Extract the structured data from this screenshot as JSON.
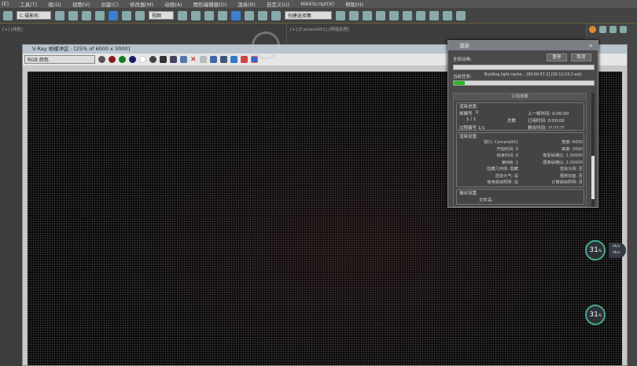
{
  "menu": [
    "(E)",
    "工具(T)",
    "组(G)",
    "视图(V)",
    "创建(C)",
    "修改器(M)",
    "动画(A)",
    "图形编辑器(D)",
    "渲染(R)",
    "自定义(U)",
    "MAXScript(X)",
    "帮助(H)"
  ],
  "toolbar": {
    "selection_filter": "C-摄影机",
    "coord_system": "视图",
    "named_selection": "创建选择集"
  },
  "viewports": {
    "left_label": "[+] [线框]",
    "right_label": "[+] [Camera001] [明暗处理]"
  },
  "vfb": {
    "title": "V-Ray 帧缓冲区 - [25% of 6000 x 3000]",
    "channel": "RGB 颜色",
    "channel_colors": [
      "#8b1a1a",
      "#1a7a1a",
      "#1a1a6a"
    ]
  },
  "render_dialog": {
    "title": "渲染",
    "all_anim_label": "全部动画:",
    "pause": "暂停",
    "cancel": "取消",
    "current_task_label": "当前任务:",
    "current_task": "Building light cache... [00:00:57.2] [00:12:53.3 est]",
    "progress_percent": 8,
    "section": "公用参数",
    "progress_group": "渲染进度:",
    "frame_no_label": "帧编号",
    "frame_no": "0",
    "last_frame_time": "上一帧时间: 0:00:00",
    "frames": "1 / 1",
    "total": "总数",
    "elapsed": "已用时间: 0:00:00",
    "pass_no": "过程编号 1/1",
    "remaining": "剩余时间: ??:??:??",
    "settings_group": "渲染设置:",
    "left": [
      "视口: Camera001",
      "开始时间: 0",
      "结束时间: 0",
      "第N帧: 1",
      "隐藏几何体: 隐藏",
      "渲染大气: 是",
      "使用高级照明: 是"
    ],
    "right": [
      "宽度: 6000",
      "高度: 3000",
      "像素纵横比: 1.00000",
      "图像纵横比: 2.00000",
      "渲染为场: 否",
      "强制双面: 否",
      "计算高级照明: 否"
    ],
    "output_group": "输出设置:",
    "filename_label": "文件名:"
  },
  "gauges": [
    {
      "value": "31",
      "unit": "%",
      "up": "0k/s",
      "down": "0k/s"
    },
    {
      "value": "31",
      "unit": "%"
    }
  ]
}
